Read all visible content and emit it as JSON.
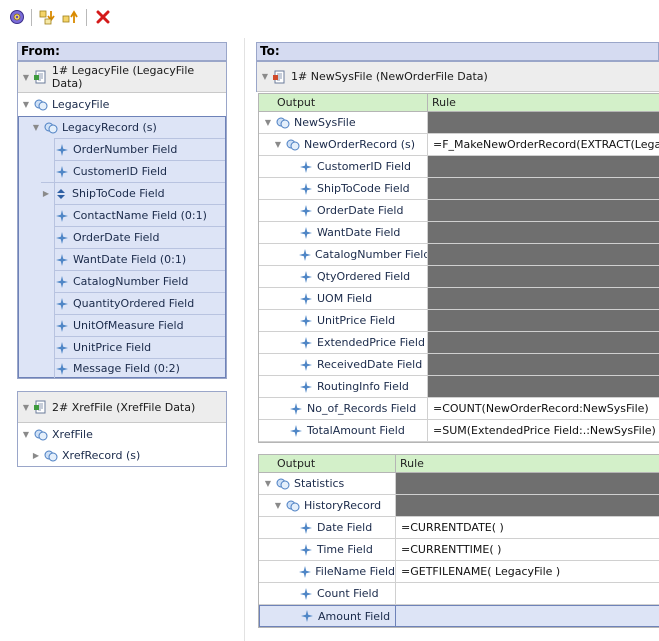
{
  "toolbar": {
    "buttons": [
      {
        "name": "settings-button",
        "icon": "gear-icon"
      },
      {
        "name": "move-down-button",
        "icon": "arrow-down-icon"
      },
      {
        "name": "move-up-button",
        "icon": "arrow-up-icon"
      },
      {
        "name": "delete-button",
        "icon": "red-x-icon"
      }
    ]
  },
  "from": {
    "header": "From:",
    "files": [
      {
        "title": "1# LegacyFile (LegacyFile Data)",
        "root": "LegacyFile",
        "record": "LegacyRecord (s)",
        "fields": [
          "OrderNumber Field",
          "CustomerID Field",
          "ShipToCode Field",
          "ContactName Field (0:1)",
          "OrderDate Field",
          "WantDate Field (0:1)",
          "CatalogNumber Field",
          "QuantityOrdered Field",
          "UnitOfMeasure Field",
          "UnitPrice Field",
          "Message Field (0:2)"
        ]
      },
      {
        "title": "2# XrefFile (XrefFile Data)",
        "root": "XrefFile",
        "record": "XrefRecord (s)"
      }
    ]
  },
  "to": {
    "header": "To:",
    "file_title": "1# NewSysFile (NewOrderFile Data)",
    "grid1": {
      "col_output": "Output",
      "col_rule": "Rule",
      "rows": [
        {
          "output": "NewSysFile",
          "rule": ""
        },
        {
          "output": "NewOrderRecord (s)",
          "rule": "=F_MakeNewOrderRecord(EXTRACT(Legacy"
        },
        {
          "output": "CustomerID Field",
          "rule": ""
        },
        {
          "output": "ShipToCode Field",
          "rule": ""
        },
        {
          "output": "OrderDate Field",
          "rule": ""
        },
        {
          "output": "WantDate Field",
          "rule": ""
        },
        {
          "output": "CatalogNumber Field",
          "rule": ""
        },
        {
          "output": "QtyOrdered Field",
          "rule": ""
        },
        {
          "output": "UOM Field",
          "rule": ""
        },
        {
          "output": "UnitPrice Field",
          "rule": ""
        },
        {
          "output": "ExtendedPrice Field",
          "rule": ""
        },
        {
          "output": "ReceivedDate Field",
          "rule": ""
        },
        {
          "output": "RoutingInfo Field",
          "rule": ""
        },
        {
          "output": "No_of_Records Field",
          "rule": "=COUNT(NewOrderRecord:NewSysFile)"
        },
        {
          "output": "TotalAmount Field",
          "rule": "=SUM(ExtendedPrice Field:.:NewSysFile)"
        }
      ]
    },
    "grid2": {
      "col_output": "Output",
      "col_rule": "Rule",
      "rows": [
        {
          "output": "Statistics",
          "rule": ""
        },
        {
          "output": "HistoryRecord",
          "rule": ""
        },
        {
          "output": "Date Field",
          "rule": "=CURRENTDATE( )"
        },
        {
          "output": "Time Field",
          "rule": "=CURRENTTIME( )"
        },
        {
          "output": "FileName Field",
          "rule": "=GETFILENAME( LegacyFile )"
        },
        {
          "output": "Count Field",
          "rule": ""
        },
        {
          "output": "Amount Field",
          "rule": ""
        }
      ]
    }
  }
}
